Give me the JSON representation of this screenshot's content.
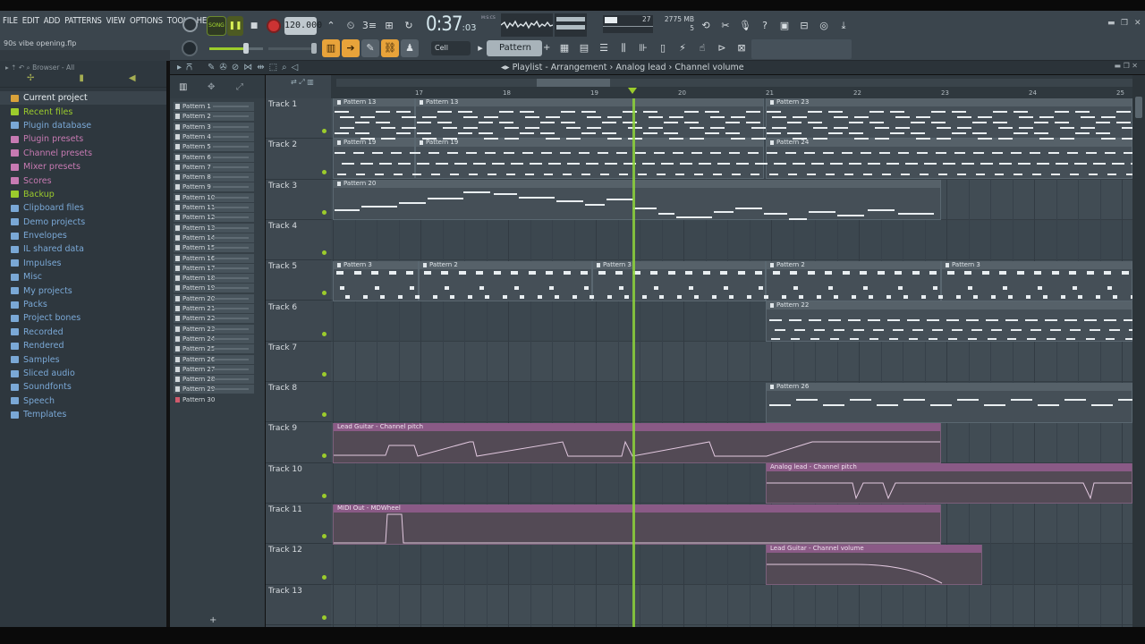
{
  "menu": [
    "FILE",
    "EDIT",
    "ADD",
    "PATTERNS",
    "VIEW",
    "OPTIONS",
    "TOOLS",
    "HELP"
  ],
  "project_file": "90s vibe opening.flp",
  "transport": {
    "mode": "SONG",
    "tempo": "120.000",
    "time_main": "0:37",
    "time_sub": ":03",
    "time_unit": "M:S:CS"
  },
  "cpu": {
    "value": "27",
    "memory": "2775 MB",
    "polyphony": "5"
  },
  "toolbar2": {
    "snap": "Cell",
    "pattern": "Pattern 30",
    "add": "+"
  },
  "browser": {
    "header": "Browser - All",
    "items": [
      {
        "label": "Current project",
        "icon": "project-icon",
        "color": "#d9a23a",
        "current": true
      },
      {
        "label": "Recent files",
        "icon": "folder-icon",
        "color": "#9ccc2c"
      },
      {
        "label": "Plugin database",
        "icon": "plug-icon",
        "color": "#7aa8d6"
      },
      {
        "label": "Plugin presets",
        "icon": "plug-icon",
        "color": "#c77ab2"
      },
      {
        "label": "Channel presets",
        "icon": "folder-icon",
        "color": "#c77ab2"
      },
      {
        "label": "Mixer presets",
        "icon": "folder-icon",
        "color": "#c77ab2"
      },
      {
        "label": "Scores",
        "icon": "note-icon",
        "color": "#c77ab2"
      },
      {
        "label": "Backup",
        "icon": "folder-icon",
        "color": "#9ccc2c"
      },
      {
        "label": "Clipboard files",
        "icon": "folder-icon",
        "color": "#7aa8d6"
      },
      {
        "label": "Demo projects",
        "icon": "folder-icon",
        "color": "#7aa8d6"
      },
      {
        "label": "Envelopes",
        "icon": "folder-icon",
        "color": "#7aa8d6"
      },
      {
        "label": "IL shared data",
        "icon": "folder-icon",
        "color": "#7aa8d6"
      },
      {
        "label": "Impulses",
        "icon": "folder-icon",
        "color": "#7aa8d6"
      },
      {
        "label": "Misc",
        "icon": "folder-icon",
        "color": "#7aa8d6"
      },
      {
        "label": "My projects",
        "icon": "folder-icon",
        "color": "#7aa8d6"
      },
      {
        "label": "Packs",
        "icon": "folder-icon",
        "color": "#7aa8d6"
      },
      {
        "label": "Project bones",
        "icon": "folder-icon",
        "color": "#7aa8d6"
      },
      {
        "label": "Recorded",
        "icon": "folder-icon",
        "color": "#7aa8d6"
      },
      {
        "label": "Rendered",
        "icon": "folder-icon",
        "color": "#7aa8d6"
      },
      {
        "label": "Samples",
        "icon": "folder-icon",
        "color": "#7aa8d6"
      },
      {
        "label": "Sliced audio",
        "icon": "folder-icon",
        "color": "#7aa8d6"
      },
      {
        "label": "Soundfonts",
        "icon": "folder-icon",
        "color": "#7aa8d6"
      },
      {
        "label": "Speech",
        "icon": "folder-icon",
        "color": "#7aa8d6"
      },
      {
        "label": "Templates",
        "icon": "folder-icon",
        "color": "#7aa8d6"
      }
    ]
  },
  "playlist": {
    "breadcrumb": "Playlist - Arrangement › Analog lead › Channel volume",
    "bar_numbers": [
      "17",
      "18",
      "19",
      "20",
      "21",
      "22",
      "23",
      "24",
      "25"
    ],
    "patterns": [
      "Pattern 1",
      "Pattern 2",
      "Pattern 3",
      "Pattern 4",
      "Pattern 5",
      "Pattern 6",
      "Pattern 7",
      "Pattern 8",
      "Pattern 9",
      "Pattern 10",
      "Pattern 11",
      "Pattern 12",
      "Pattern 13",
      "Pattern 14",
      "Pattern 15",
      "Pattern 16",
      "Pattern 17",
      "Pattern 18",
      "Pattern 19",
      "Pattern 20",
      "Pattern 21",
      "Pattern 22",
      "Pattern 23",
      "Pattern 24",
      "Pattern 25",
      "Pattern 26",
      "Pattern 27",
      "Pattern 28",
      "Pattern 29",
      "Pattern 30"
    ],
    "selected_pattern": "Pattern 30",
    "tracks": [
      "Track 1",
      "Track 2",
      "Track 3",
      "Track 4",
      "Track 5",
      "Track 6",
      "Track 7",
      "Track 8",
      "Track 9",
      "Track 10",
      "Track 11",
      "Track 12",
      "Track 13"
    ],
    "clips": {
      "t1a": "Pattern 13",
      "t1b": "Pattern 13",
      "t1c": "Pattern 23",
      "t2a": "Pattern 19",
      "t2b": "Pattern 19",
      "t2c": "Pattern 24",
      "t3a": "Pattern 20",
      "t5a": "Pattern 3",
      "t5b": "Pattern 2",
      "t5c": "Pattern 3",
      "t5d": "Pattern 2",
      "t5e": "Pattern 3",
      "t6a": "Pattern 22",
      "t8a": "Pattern 26",
      "t9a": "Lead Guitar - Channel pitch",
      "t10a": "Analog lead - Channel pitch",
      "t11a": "MIDI Out - MDWheel",
      "t12a": "Lead Guitar - Channel volume"
    }
  }
}
